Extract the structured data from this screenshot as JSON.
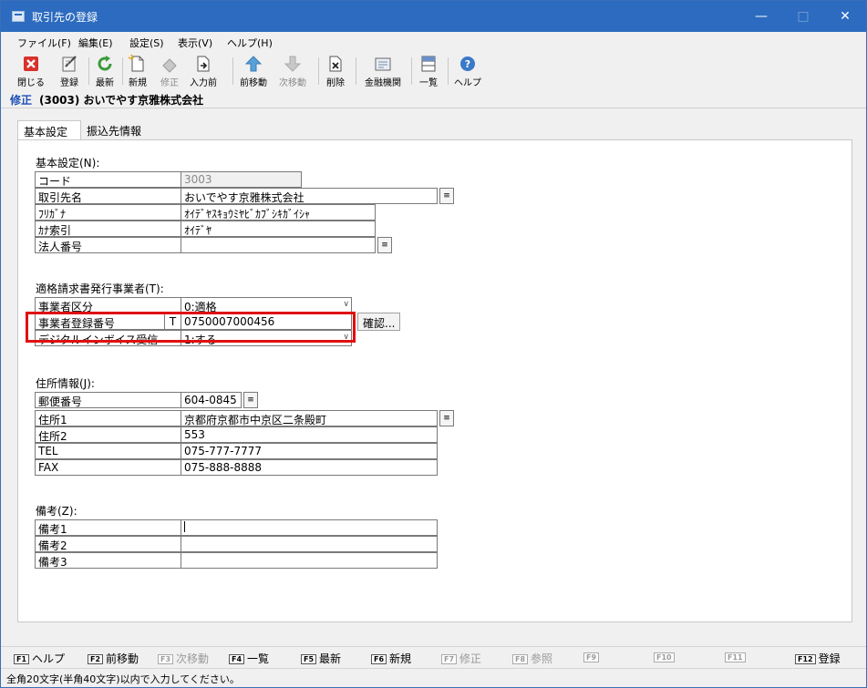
{
  "window": {
    "title": "取引先の登録"
  },
  "menu": [
    "ファイル(F)",
    "編集(E)",
    "設定(S)",
    "表示(V)",
    "ヘルプ(H)"
  ],
  "toolbar": {
    "close": "閉じる",
    "register": "登録",
    "refresh": "最新",
    "new": "新規",
    "edit": "修正",
    "before_input": "入力前",
    "prev": "前移動",
    "next": "次移動",
    "delete": "削除",
    "bank": "金融機関",
    "list": "一覧",
    "help": "ヘルプ"
  },
  "mode": {
    "label": "修正",
    "partner": "(3003) おいでやす京雅株式会社"
  },
  "tabs": [
    "基本設定",
    "振込先情報"
  ],
  "basic": {
    "section": "基本設定(N):",
    "code_label": "コード",
    "code": "3003",
    "name_label": "取引先名",
    "name": "おいでやす京雅株式会社",
    "kana_label": "ﾌﾘｶﾞﾅ",
    "kana": "ｵｲﾃﾞﾔｽｷｮｳﾐﾔﾋﾞｶﾌﾞｼｷｶﾞｲｼｬ",
    "index_label": "ｶﾅ索引",
    "index": "ｵｲﾃﾞﾔ",
    "corp_label": "法人番号",
    "corp": ""
  },
  "invoice": {
    "section": "適格請求書発行事業者(T):",
    "type_label": "事業者区分",
    "type": "0:適格",
    "reg_label": "事業者登録番号",
    "reg_prefix": "T",
    "reg": "0750007000456",
    "confirm": "確認...",
    "digital_label": "デジタルインボイス受信",
    "digital": "1:する"
  },
  "address": {
    "section": "住所情報(J):",
    "zip_label": "郵便番号",
    "zip": "604-0845",
    "addr1_label": "住所1",
    "addr1": "京都府京都市中京区二条殿町",
    "addr2_label": "住所2",
    "addr2": "553",
    "tel_label": "TEL",
    "tel": "075-777-7777",
    "fax_label": "FAX",
    "fax": "075-888-8888"
  },
  "notes": {
    "section": "備考(Z):",
    "n1_label": "備考1",
    "n1": "",
    "n2_label": "備考2",
    "n2": "",
    "n3_label": "備考3",
    "n3": ""
  },
  "fkeys": [
    {
      "key": "F1",
      "label": "ヘルプ"
    },
    {
      "key": "F2",
      "label": "前移動"
    },
    {
      "key": "F3",
      "label": "次移動"
    },
    {
      "key": "F4",
      "label": "一覧"
    },
    {
      "key": "F5",
      "label": "最新"
    },
    {
      "key": "F6",
      "label": "新規"
    },
    {
      "key": "F7",
      "label": "修正"
    },
    {
      "key": "F8",
      "label": "参照"
    },
    {
      "key": "F9",
      "label": ""
    },
    {
      "key": "F10",
      "label": ""
    },
    {
      "key": "F11",
      "label": ""
    },
    {
      "key": "F12",
      "label": "登録"
    }
  ],
  "status": "全角20文字(半角40文字)以内で入力してください。",
  "colors": {
    "titlebar": "#2c6bbf",
    "mode_text": "#1f4fb5",
    "highlight": "#e01010"
  }
}
